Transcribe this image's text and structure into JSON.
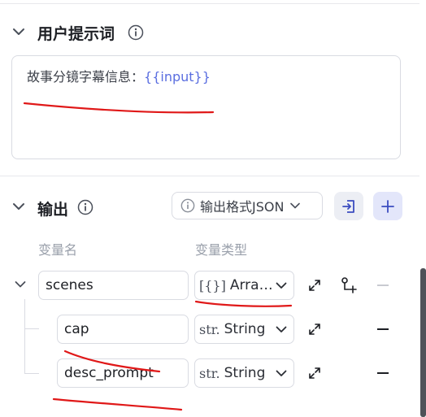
{
  "user_prompt": {
    "title": "用户提示词",
    "text_prefix": "故事分镜字幕信息：",
    "variable_token": "{{input}}"
  },
  "output": {
    "title": "输出",
    "format_select": "输出格式JSON",
    "col_name": "变量名",
    "col_type": "变量类型",
    "rows": [
      {
        "name": "scenes",
        "type_prefix": "[{}]",
        "type": "Arra…"
      },
      {
        "name": "cap",
        "type_prefix": "str.",
        "type": "String"
      },
      {
        "name": "desc_prompt",
        "type_prefix": "str.",
        "type": "String"
      }
    ]
  },
  "colors": {
    "annotation_red": "#e01818",
    "variable_blue": "#5a6ee0",
    "border": "#d9dbe2"
  }
}
